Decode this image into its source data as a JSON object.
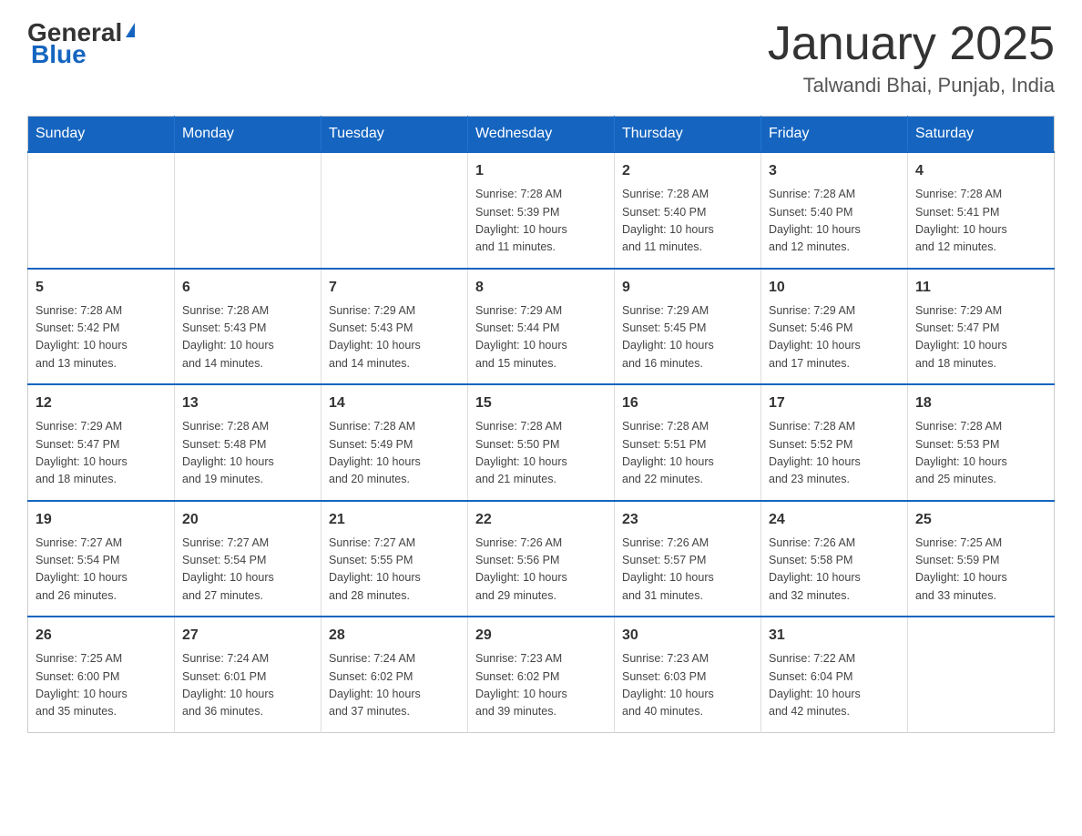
{
  "header": {
    "logo_general": "General",
    "logo_blue": "Blue",
    "month_title": "January 2025",
    "location": "Talwandi Bhai, Punjab, India"
  },
  "days_of_week": [
    "Sunday",
    "Monday",
    "Tuesday",
    "Wednesday",
    "Thursday",
    "Friday",
    "Saturday"
  ],
  "weeks": [
    [
      {
        "day": "",
        "info": ""
      },
      {
        "day": "",
        "info": ""
      },
      {
        "day": "",
        "info": ""
      },
      {
        "day": "1",
        "info": "Sunrise: 7:28 AM\nSunset: 5:39 PM\nDaylight: 10 hours\nand 11 minutes."
      },
      {
        "day": "2",
        "info": "Sunrise: 7:28 AM\nSunset: 5:40 PM\nDaylight: 10 hours\nand 11 minutes."
      },
      {
        "day": "3",
        "info": "Sunrise: 7:28 AM\nSunset: 5:40 PM\nDaylight: 10 hours\nand 12 minutes."
      },
      {
        "day": "4",
        "info": "Sunrise: 7:28 AM\nSunset: 5:41 PM\nDaylight: 10 hours\nand 12 minutes."
      }
    ],
    [
      {
        "day": "5",
        "info": "Sunrise: 7:28 AM\nSunset: 5:42 PM\nDaylight: 10 hours\nand 13 minutes."
      },
      {
        "day": "6",
        "info": "Sunrise: 7:28 AM\nSunset: 5:43 PM\nDaylight: 10 hours\nand 14 minutes."
      },
      {
        "day": "7",
        "info": "Sunrise: 7:29 AM\nSunset: 5:43 PM\nDaylight: 10 hours\nand 14 minutes."
      },
      {
        "day": "8",
        "info": "Sunrise: 7:29 AM\nSunset: 5:44 PM\nDaylight: 10 hours\nand 15 minutes."
      },
      {
        "day": "9",
        "info": "Sunrise: 7:29 AM\nSunset: 5:45 PM\nDaylight: 10 hours\nand 16 minutes."
      },
      {
        "day": "10",
        "info": "Sunrise: 7:29 AM\nSunset: 5:46 PM\nDaylight: 10 hours\nand 17 minutes."
      },
      {
        "day": "11",
        "info": "Sunrise: 7:29 AM\nSunset: 5:47 PM\nDaylight: 10 hours\nand 18 minutes."
      }
    ],
    [
      {
        "day": "12",
        "info": "Sunrise: 7:29 AM\nSunset: 5:47 PM\nDaylight: 10 hours\nand 18 minutes."
      },
      {
        "day": "13",
        "info": "Sunrise: 7:28 AM\nSunset: 5:48 PM\nDaylight: 10 hours\nand 19 minutes."
      },
      {
        "day": "14",
        "info": "Sunrise: 7:28 AM\nSunset: 5:49 PM\nDaylight: 10 hours\nand 20 minutes."
      },
      {
        "day": "15",
        "info": "Sunrise: 7:28 AM\nSunset: 5:50 PM\nDaylight: 10 hours\nand 21 minutes."
      },
      {
        "day": "16",
        "info": "Sunrise: 7:28 AM\nSunset: 5:51 PM\nDaylight: 10 hours\nand 22 minutes."
      },
      {
        "day": "17",
        "info": "Sunrise: 7:28 AM\nSunset: 5:52 PM\nDaylight: 10 hours\nand 23 minutes."
      },
      {
        "day": "18",
        "info": "Sunrise: 7:28 AM\nSunset: 5:53 PM\nDaylight: 10 hours\nand 25 minutes."
      }
    ],
    [
      {
        "day": "19",
        "info": "Sunrise: 7:27 AM\nSunset: 5:54 PM\nDaylight: 10 hours\nand 26 minutes."
      },
      {
        "day": "20",
        "info": "Sunrise: 7:27 AM\nSunset: 5:54 PM\nDaylight: 10 hours\nand 27 minutes."
      },
      {
        "day": "21",
        "info": "Sunrise: 7:27 AM\nSunset: 5:55 PM\nDaylight: 10 hours\nand 28 minutes."
      },
      {
        "day": "22",
        "info": "Sunrise: 7:26 AM\nSunset: 5:56 PM\nDaylight: 10 hours\nand 29 minutes."
      },
      {
        "day": "23",
        "info": "Sunrise: 7:26 AM\nSunset: 5:57 PM\nDaylight: 10 hours\nand 31 minutes."
      },
      {
        "day": "24",
        "info": "Sunrise: 7:26 AM\nSunset: 5:58 PM\nDaylight: 10 hours\nand 32 minutes."
      },
      {
        "day": "25",
        "info": "Sunrise: 7:25 AM\nSunset: 5:59 PM\nDaylight: 10 hours\nand 33 minutes."
      }
    ],
    [
      {
        "day": "26",
        "info": "Sunrise: 7:25 AM\nSunset: 6:00 PM\nDaylight: 10 hours\nand 35 minutes."
      },
      {
        "day": "27",
        "info": "Sunrise: 7:24 AM\nSunset: 6:01 PM\nDaylight: 10 hours\nand 36 minutes."
      },
      {
        "day": "28",
        "info": "Sunrise: 7:24 AM\nSunset: 6:02 PM\nDaylight: 10 hours\nand 37 minutes."
      },
      {
        "day": "29",
        "info": "Sunrise: 7:23 AM\nSunset: 6:02 PM\nDaylight: 10 hours\nand 39 minutes."
      },
      {
        "day": "30",
        "info": "Sunrise: 7:23 AM\nSunset: 6:03 PM\nDaylight: 10 hours\nand 40 minutes."
      },
      {
        "day": "31",
        "info": "Sunrise: 7:22 AM\nSunset: 6:04 PM\nDaylight: 10 hours\nand 42 minutes."
      },
      {
        "day": "",
        "info": ""
      }
    ]
  ]
}
